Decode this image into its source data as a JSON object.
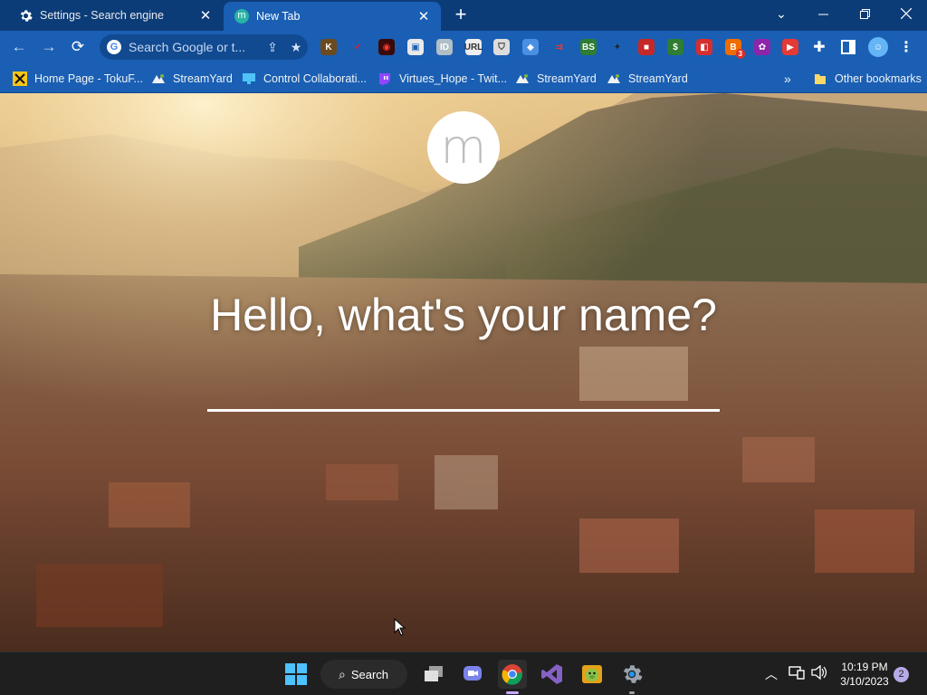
{
  "tabs": [
    {
      "title": "Settings - Search engine",
      "icon": "gear-icon",
      "active": false
    },
    {
      "title": "New Tab",
      "icon": "momentum-icon",
      "active": true
    }
  ],
  "toolbar": {
    "omnibox_placeholder": "Search Google or t...",
    "extensions": [
      {
        "name": "k-extension-icon",
        "label": "K",
        "color": "#6b4a1e"
      },
      {
        "name": "check-extension-icon",
        "label": "✔",
        "color": "#1a5fb4",
        "fg": "#e02020"
      },
      {
        "name": "record-extension-icon",
        "label": "◉",
        "color": "#3a0a0a",
        "fg": "#ff3b30"
      },
      {
        "name": "doc-extension-icon",
        "label": "▣",
        "color": "#eaeaea",
        "fg": "#1a5fb4"
      },
      {
        "name": "id-extension-icon",
        "label": "ID",
        "color": "#b0bec5"
      },
      {
        "name": "url-extension-icon",
        "label": "URL",
        "color": "#eee",
        "fg": "#333"
      },
      {
        "name": "shield-extension-icon",
        "label": "⛉",
        "color": "#ddd",
        "fg": "#333"
      },
      {
        "name": "puzzle-blue-extension-icon",
        "label": "◆",
        "color": "#4a90e2"
      },
      {
        "name": "arrow-extension-icon",
        "label": "⇉",
        "color": "#1a5fb4",
        "fg": "#e53935"
      },
      {
        "name": "bs-extension-icon",
        "label": "BS",
        "color": "#2e7d32"
      },
      {
        "name": "pin-extension-icon",
        "label": "✦",
        "color": "#1a5fb4",
        "fg": "#222"
      },
      {
        "name": "red-extension-icon",
        "label": "■",
        "color": "#c62828"
      },
      {
        "name": "dollar-extension-icon",
        "label": "$",
        "color": "#2e7d32"
      },
      {
        "name": "screenshot-extension-icon",
        "label": "◧",
        "color": "#d32f2f"
      },
      {
        "name": "badge-extension-icon",
        "label": "B",
        "color": "#ef6c00",
        "badge": "3"
      },
      {
        "name": "honey-extension-icon",
        "label": "✿",
        "color": "#8e24aa"
      },
      {
        "name": "youtube-extension-icon",
        "label": "▶",
        "color": "#e53935"
      }
    ]
  },
  "bookmarks": [
    {
      "label": "Home Page - TokuF...",
      "icon": "tokufu-icon"
    },
    {
      "label": "StreamYard",
      "icon": "streamyard-icon"
    },
    {
      "label": "Control Collaborati...",
      "icon": "monitor-icon"
    },
    {
      "label": "Virtues_Hope - Twit...",
      "icon": "twitch-icon"
    },
    {
      "label": "StreamYard",
      "icon": "streamyard-icon"
    },
    {
      "label": "StreamYard",
      "icon": "streamyard-icon"
    }
  ],
  "other_bookmarks": "Other bookmarks",
  "page": {
    "logo_letter": "m",
    "greeting": "Hello, what's your name?",
    "name_value": ""
  },
  "taskbar": {
    "search_label": "Search",
    "time": "10:19 PM",
    "date": "3/10/2023",
    "notification_count": "2"
  }
}
